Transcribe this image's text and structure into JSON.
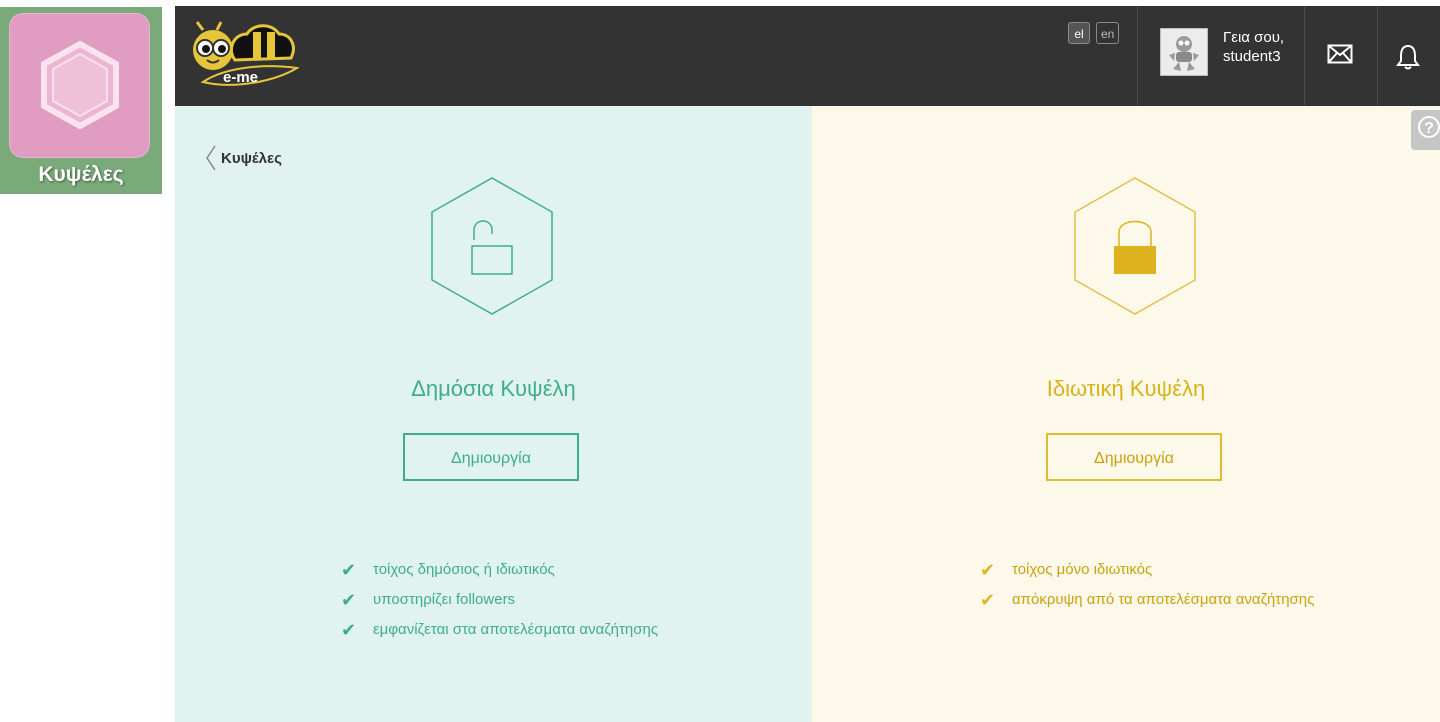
{
  "app_tile": {
    "label": "Κυψέλες"
  },
  "topbar": {
    "logo_text": "e-me",
    "languages": [
      "el",
      "en"
    ],
    "greeting_line1": "Γεια σου,",
    "greeting_line2": "student3"
  },
  "breadcrumb": {
    "back_label": "Κυψέλες"
  },
  "public_panel": {
    "title": "Δημόσια Κυψέλη",
    "create_label": "Δημιουργία",
    "features": [
      "τοίχος δημόσιος ή ιδιωτικός",
      "υποστηρίζει followers",
      "εμφανίζεται στα αποτελέσματα αναζήτησης"
    ],
    "icon": "unlocked-padlock-icon",
    "accent": "#3fae88",
    "background": "#e0f3ee"
  },
  "private_panel": {
    "title": "Ιδιωτική Κυψέλη",
    "create_label": "Δημιουργία",
    "features": [
      "τοίχος μόνο ιδιωτικός",
      "απόκρυψη από τα αποτελέσματα αναζήτησης"
    ],
    "icon": "locked-padlock-icon",
    "accent": "#dfbd2c",
    "background": "#fdf9ea"
  },
  "help": {
    "label": "?"
  },
  "colors": {
    "topbar": "#333333",
    "tile": "#e19cc2",
    "tile_frame": "#7aa97a"
  }
}
